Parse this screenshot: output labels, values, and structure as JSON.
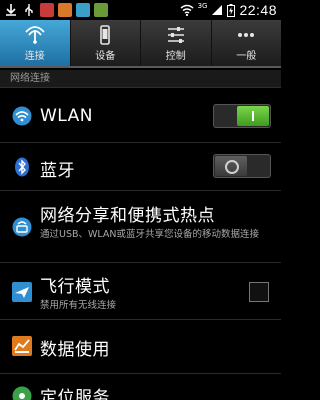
{
  "status_bar": {
    "network": "3G",
    "time": "22:48"
  },
  "tabs": [
    {
      "label": "连接",
      "icon": "connections-icon",
      "active": true
    },
    {
      "label": "设备",
      "icon": "device-icon",
      "active": false
    },
    {
      "label": "控制",
      "icon": "controls-icon",
      "active": false
    },
    {
      "label": "一般",
      "icon": "more-icon",
      "active": false
    }
  ],
  "section_header": "网络连接",
  "rows": {
    "wlan": {
      "title": "WLAN",
      "icon": "wifi-icon",
      "toggle": "on"
    },
    "bluetooth": {
      "title": "蓝牙",
      "icon": "bluetooth-icon",
      "toggle": "off"
    },
    "tethering": {
      "title": "网络分享和便携式热点",
      "subtitle": "通过USB、WLAN或蓝牙共享您设备的移动数据连接",
      "icon": "tethering-icon"
    },
    "airplane": {
      "title": "飞行模式",
      "subtitle": "禁用所有无线连接",
      "icon": "airplane-icon",
      "checked": false
    },
    "data_usage": {
      "title": "数据使用",
      "icon": "data-usage-icon"
    },
    "location": {
      "title": "定位服务",
      "icon": "location-icon"
    }
  },
  "colors": {
    "accent": "#33a0d8",
    "toggle_on": "#5fc233"
  }
}
